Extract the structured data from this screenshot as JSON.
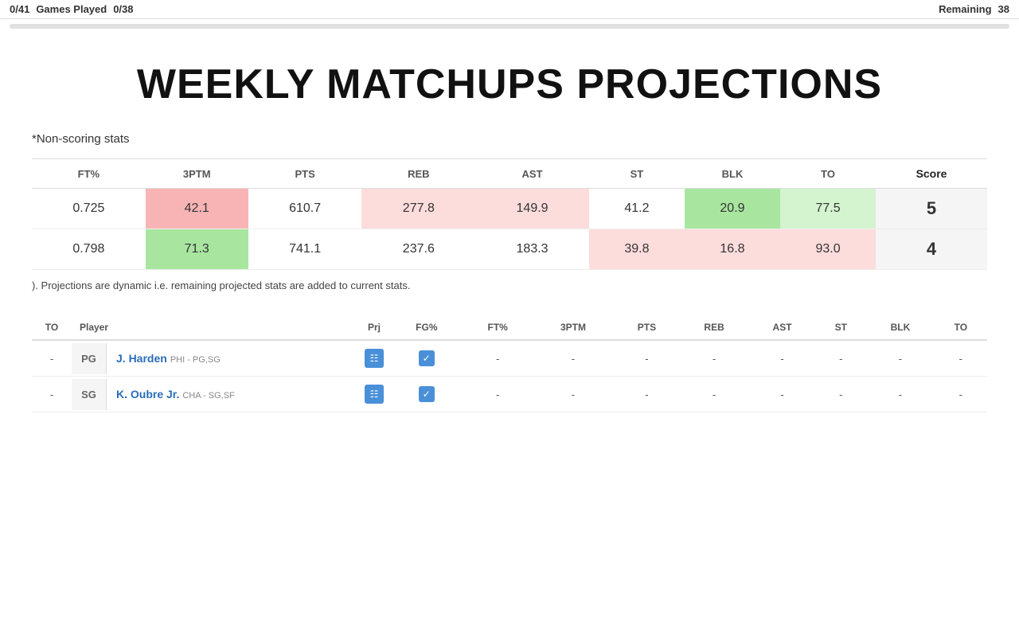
{
  "topBar": {
    "leftScore": "0/41",
    "gamesPlayedLabel": "Games Played",
    "rightScore": "0/38",
    "remainingLabel": "Remaining",
    "remainingValue": "38"
  },
  "pageTitle": "WEEKLY MATCHUPS PROJECTIONS",
  "subtitle": "*Non-scoring stats",
  "matchupTable": {
    "headers": [
      "FT%",
      "3PTM",
      "PTS",
      "REB",
      "AST",
      "ST",
      "BLK",
      "TO",
      "Score"
    ],
    "rows": [
      {
        "ft": "0.725",
        "tptm": "42.1",
        "pts": "610.7",
        "reb": "277.8",
        "ast": "149.9",
        "st": "41.2",
        "blk": "20.9",
        "to": "77.5",
        "score": "5",
        "tptmClass": "cell-red",
        "ptsClass": "",
        "rebClass": "cell-light-red",
        "astClass": "cell-light-red",
        "stClass": "",
        "blkClass": "cell-green",
        "toClass": "cell-light-green",
        "scoreClass": "cell-score-win"
      },
      {
        "ft": "0.798",
        "tptm": "71.3",
        "pts": "741.1",
        "reb": "237.6",
        "ast": "183.3",
        "st": "39.8",
        "blk": "16.8",
        "to": "93.0",
        "score": "4",
        "tptmClass": "cell-green",
        "ptsClass": "",
        "rebClass": "",
        "astClass": "",
        "stClass": "cell-light-red",
        "blkClass": "cell-light-red",
        "toClass": "cell-light-red",
        "scoreClass": "cell-score-win"
      }
    ]
  },
  "noteText": "). Projections are dynamic i.e. remaining projected stats are added to current stats.",
  "playerTable": {
    "headers": [
      "TO",
      "Player",
      "Prj",
      "FG%",
      "FT%",
      "3PTM",
      "PTS",
      "REB",
      "AST",
      "ST",
      "BLK",
      "TO"
    ],
    "rows": [
      {
        "to": "-",
        "pos": "PG",
        "playerName": "J. Harden",
        "playerTeam": "PHI - PG,SG",
        "prjIcon": "doc",
        "checkIcon": "check",
        "fg": "-",
        "ft": "-",
        "tptm": "-",
        "pts": "-",
        "reb": "-",
        "ast": "-",
        "st": "-",
        "blk": "-"
      },
      {
        "to": "-",
        "pos": "SG",
        "playerName": "K. Oubre Jr.",
        "playerTeam": "CHA - SG,SF",
        "prjIcon": "doc",
        "checkIcon": "check",
        "fg": "-",
        "ft": "-",
        "tptm": "-",
        "pts": "-",
        "reb": "-",
        "ast": "-",
        "st": "-",
        "blk": "-"
      }
    ]
  }
}
